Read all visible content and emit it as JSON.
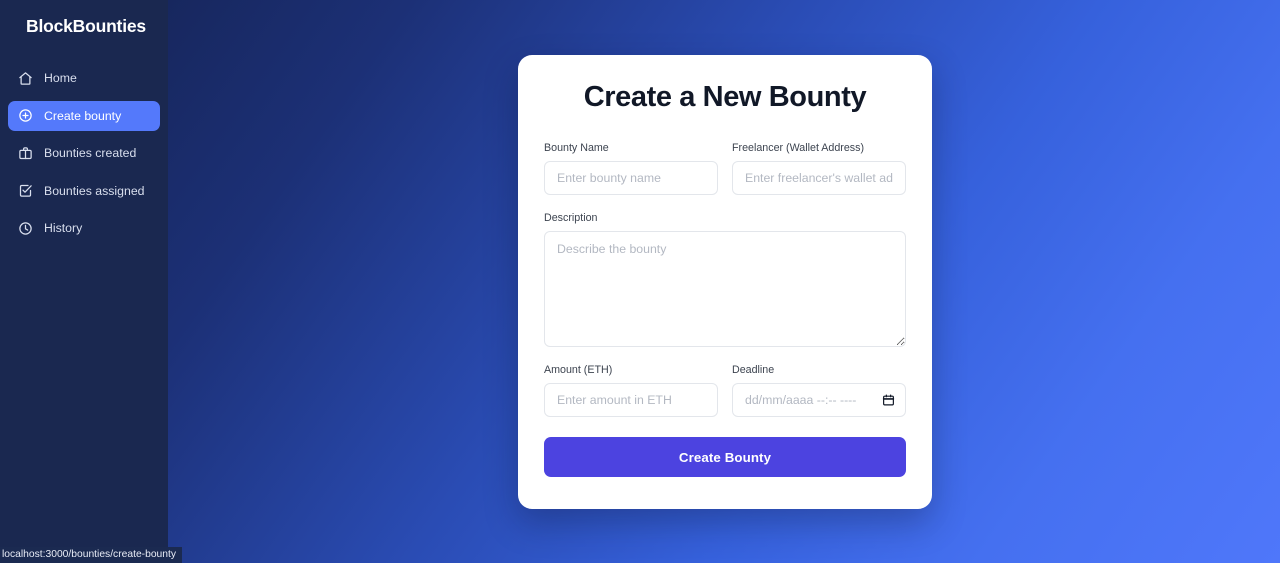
{
  "sidebar": {
    "brand": "BlockBounties",
    "items": [
      {
        "label": "Home",
        "icon": "home-icon",
        "active": false
      },
      {
        "label": "Create bounty",
        "icon": "plus-circle-icon",
        "active": true
      },
      {
        "label": "Bounties created",
        "icon": "briefcase-icon",
        "active": false
      },
      {
        "label": "Bounties assigned",
        "icon": "check-square-icon",
        "active": false
      },
      {
        "label": "History",
        "icon": "clock-icon",
        "active": false
      }
    ],
    "background_color": "#1a2850",
    "active_color": "#5479fb"
  },
  "card": {
    "title": "Create a New Bounty",
    "fields": {
      "bounty_name": {
        "label": "Bounty Name",
        "placeholder": "Enter bounty name",
        "value": ""
      },
      "freelancer": {
        "label": "Freelancer (Wallet Address)",
        "placeholder": "Enter freelancer's wallet address",
        "value": ""
      },
      "description": {
        "label": "Description",
        "placeholder": "Describe the bounty",
        "value": ""
      },
      "amount": {
        "label": "Amount (ETH)",
        "placeholder": "Enter amount in ETH",
        "value": ""
      },
      "deadline": {
        "label": "Deadline",
        "placeholder": "dd/mm/aaaa --:-- ----",
        "value": "",
        "icon": "calendar-icon"
      }
    },
    "submit_label": "Create Bounty",
    "submit_color": "#4c43e0"
  },
  "statusbar": {
    "url": "localhost:3000/bounties/create-bounty"
  },
  "background": {
    "gradient_from": "#17275e",
    "gradient_to": "#4f77fa"
  }
}
